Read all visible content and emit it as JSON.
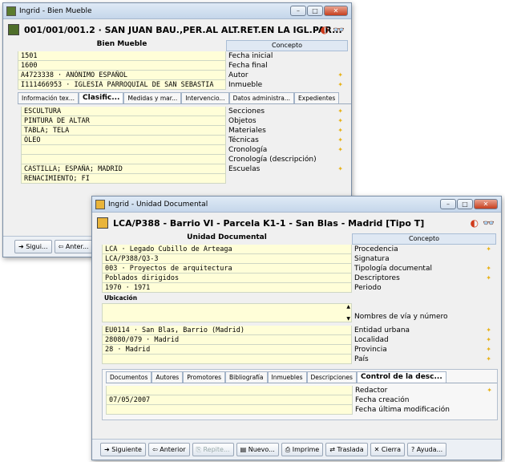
{
  "back": {
    "title": "Ingrid - Bien Mueble",
    "header": "001/001/001.2 · SAN JUAN BAU.,PER.AL ALT.RET.EN LA IGL.PAR...",
    "col_left": "Bien Mueble",
    "col_right": "Concepto",
    "rows": [
      {
        "value": "1501",
        "label": "Fecha inicial",
        "star": false
      },
      {
        "value": "1600",
        "label": "Fecha final",
        "star": false
      },
      {
        "value": "A4723338 · ANÓNIMO ESPAÑOL",
        "label": "Autor",
        "star": true
      },
      {
        "value": "I111466953 · IGLESIA PARROQUIAL DE SAN SEBASTIA",
        "label": "Inmueble",
        "star": true
      }
    ],
    "tabs": [
      "Información tex...",
      "Clasific...",
      "Medidas y mar...",
      "Intervencio...",
      "Datos administra...",
      "Expedientes"
    ],
    "rows2": [
      {
        "value": "ESCULTURA",
        "label": "Secciones",
        "star": true
      },
      {
        "value": "PINTURA DE ALTAR",
        "label": "Objetos",
        "star": true
      },
      {
        "value": "TABLA; TELA",
        "label": "Materiales",
        "star": true
      },
      {
        "value": "ÓLEO",
        "label": "Técnicas",
        "star": true
      },
      {
        "value": "",
        "label": "Cronología",
        "star": true
      },
      {
        "value": "",
        "label": "Cronología (descripción)",
        "star": false
      },
      {
        "value": "CASTILLA; ESPAÑA; MADRID",
        "label": "Escuelas",
        "star": true
      },
      {
        "value": "RENACIMIENTO; FI",
        "label": "",
        "star": false
      }
    ],
    "buttons": [
      "Sigui...",
      "Anter..."
    ]
  },
  "front": {
    "title": "Ingrid - Unidad Documental",
    "header": "LCA/P388 - Barrio VI - Parcela K1-1 - San Blas - Madrid [Tipo T]",
    "col_left": "Unidad Documental",
    "col_right": "Concepto",
    "rows": [
      {
        "value": "LCA · Legado Cubillo de Arteaga",
        "label": "Procedencia",
        "star": true
      },
      {
        "value": "LCA/P388/Q3-3",
        "label": "Signatura",
        "star": false
      },
      {
        "value": "003 · Proyectos de arquitectura",
        "label": "Tipología documental",
        "star": true
      },
      {
        "value": "Poblados dirigidos",
        "label": "Descriptores",
        "star": true
      },
      {
        "value": "1970 · 1971",
        "label": "Periodo",
        "star": false
      }
    ],
    "ubicacion": "Ubicación",
    "nombres": "Nombres de vía y número",
    "rows3": [
      {
        "value": "EU0114 · San Blas, Barrio (Madrid)",
        "label": "Entidad urbana",
        "star": true
      },
      {
        "value": "28080/079 · Madrid",
        "label": "Localidad",
        "star": true
      },
      {
        "value": "28 · Madrid",
        "label": "Provincia",
        "star": true
      },
      {
        "value": "",
        "label": "País",
        "star": true
      }
    ],
    "tabs": [
      "Documentos",
      "Autores",
      "Promotores",
      "Bibliografía",
      "Inmuebles",
      "Descripciones",
      "Control de la desc..."
    ],
    "rows4": [
      {
        "value": "",
        "label": "Redactor",
        "star": true
      },
      {
        "value": "07/05/2007",
        "label": "Fecha creación",
        "star": false
      },
      {
        "value": "",
        "label": "Fecha última modificación",
        "star": false
      }
    ],
    "buttons": [
      "Siguiente",
      "Anterior",
      "Repite...",
      "Nuevo...",
      "Imprime",
      "Traslada",
      "Cierra",
      "Ayuda..."
    ]
  }
}
